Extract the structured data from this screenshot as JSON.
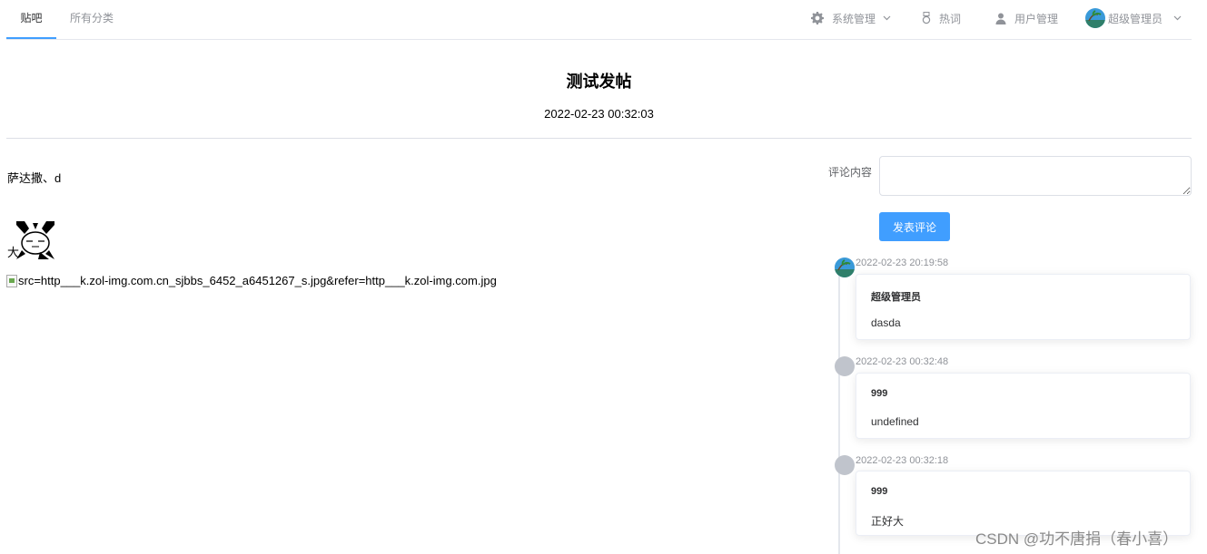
{
  "nav": {
    "tabs": [
      {
        "label": "贴吧",
        "active": true
      },
      {
        "label": "所有分类",
        "active": false
      }
    ],
    "system_menu": {
      "label": "系统管理",
      "icon": "gear-icon"
    },
    "hot": {
      "label": "热词",
      "icon": "medal-icon"
    },
    "users": {
      "label": "用户管理",
      "icon": "user-icon"
    },
    "account": {
      "label": "超级管理员",
      "icon": "avatar"
    },
    "accent": "#409eff"
  },
  "post": {
    "title": "测试发帖",
    "date": "2022-02-23 00:32:03",
    "paragraph1": "萨达撒、d",
    "paragraph2": "大",
    "broken_image_alt": "src=http___k.zol-img.com.cn_sjbbs_6452_a6451267_s.jpg&refer=http___k.zol-img.com.jpg"
  },
  "comment_form": {
    "label": "评论内容",
    "value": "",
    "submit_label": "发表评论"
  },
  "comments": [
    {
      "time": "2022-02-23 20:19:58",
      "user": "超级管理员",
      "text": "dasda",
      "has_avatar": true
    },
    {
      "time": "2022-02-23 00:32:48",
      "user": "999",
      "text": "undefined",
      "has_avatar": false
    },
    {
      "time": "2022-02-23 00:32:18",
      "user": "999",
      "text": "正好大",
      "has_avatar": false
    }
  ],
  "watermark": "CSDN @功不唐捐（春小喜）"
}
